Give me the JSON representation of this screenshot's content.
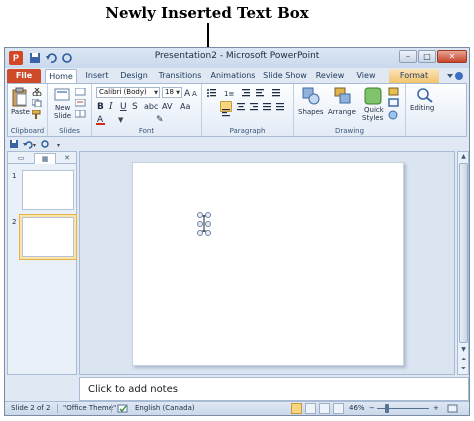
{
  "annotation": {
    "label": "Newly Inserted Text Box"
  },
  "window": {
    "title": "Presentation2 - Microsoft PowerPoint",
    "app_icon_letter": "P",
    "buttons": {
      "minimize": "–",
      "restore": "□",
      "close": "✕"
    }
  },
  "ribbon_tabs": [
    {
      "label": "File"
    },
    {
      "label": "Home"
    },
    {
      "label": "Insert"
    },
    {
      "label": "Design"
    },
    {
      "label": "Transitions"
    },
    {
      "label": "Animations"
    },
    {
      "label": "Slide Show"
    },
    {
      "label": "Review"
    },
    {
      "label": "View"
    },
    {
      "label": "Format"
    }
  ],
  "ribbon": {
    "clipboard": {
      "label": "Clipboard",
      "paste": "Paste"
    },
    "slides": {
      "label": "Slides",
      "new_slide_line1": "New",
      "new_slide_line2": "Slide"
    },
    "font": {
      "label": "Font",
      "font_name": "Calibri (Body)",
      "font_size": "18"
    },
    "paragraph": {
      "label": "Paragraph"
    },
    "drawing": {
      "label": "Drawing",
      "shapes": "Shapes",
      "arrange": "Arrange",
      "quick_styles_line1": "Quick",
      "quick_styles_line2": "Styles"
    },
    "editing": {
      "label": "Editing"
    }
  },
  "thumbnails": [
    {
      "number": "1",
      "selected": false
    },
    {
      "number": "2",
      "selected": true
    }
  ],
  "notes": {
    "placeholder": "Click to add notes"
  },
  "status": {
    "slide_info": "Slide 2 of 2",
    "theme": "\"Office Theme\"",
    "language": "English (Canada)",
    "zoom": "46%",
    "zoom_fraction": 0.46
  },
  "colors": {
    "file_tab": "#cf4a29",
    "format_tab": "#f2c46e",
    "accent": "#1e395b"
  }
}
